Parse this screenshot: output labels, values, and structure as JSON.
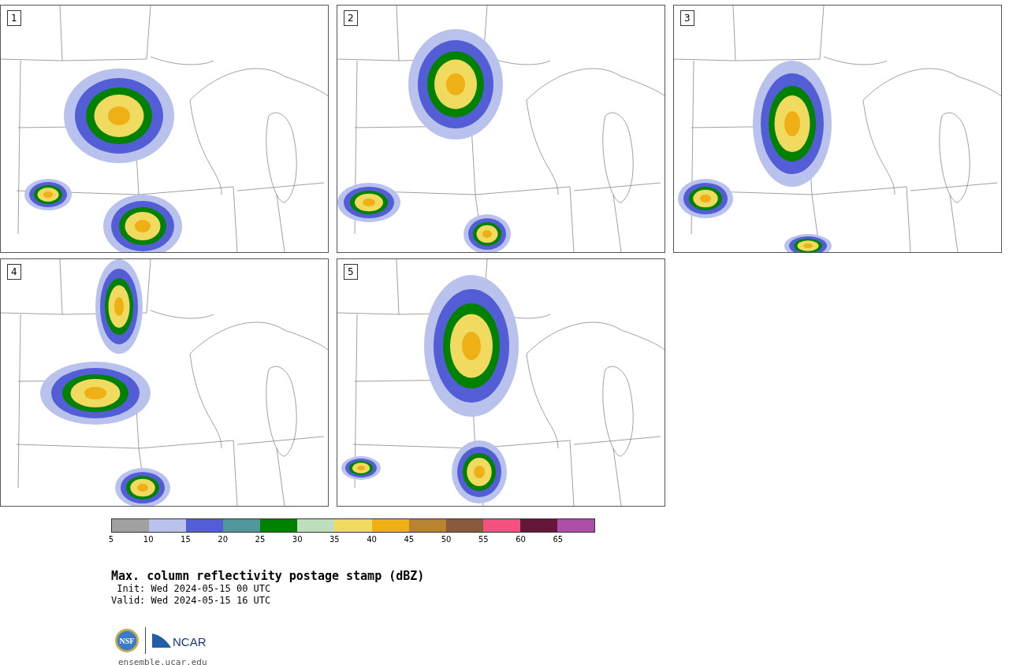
{
  "panels": [
    {
      "label": "1"
    },
    {
      "label": "2"
    },
    {
      "label": "3"
    },
    {
      "label": "4"
    },
    {
      "label": "5"
    }
  ],
  "colorbar": {
    "segments": [
      {
        "color": "#a0a0a0"
      },
      {
        "color": "#b8c2ec"
      },
      {
        "color": "#535ed6"
      },
      {
        "color": "#4f979b"
      },
      {
        "color": "#008200"
      },
      {
        "color": "#bedebe"
      },
      {
        "color": "#f0da5f"
      },
      {
        "color": "#efb016"
      },
      {
        "color": "#b98430"
      },
      {
        "color": "#8a5a3e"
      },
      {
        "color": "#f45080"
      },
      {
        "color": "#641738"
      },
      {
        "color": "#ad4ea8"
      }
    ],
    "ticks": [
      "5",
      "10",
      "15",
      "20",
      "25",
      "30",
      "35",
      "40",
      "45",
      "50",
      "55",
      "60",
      "65"
    ]
  },
  "title": "Max. column reflectivity postage stamp (dBZ)",
  "init": " Init: Wed 2024-05-15 00 UTC",
  "valid": "Valid: Wed 2024-05-15 16 UTC",
  "logos": {
    "nsf": "NSF",
    "ncar": "NCAR"
  },
  "site": "ensemble.ucar.edu"
}
